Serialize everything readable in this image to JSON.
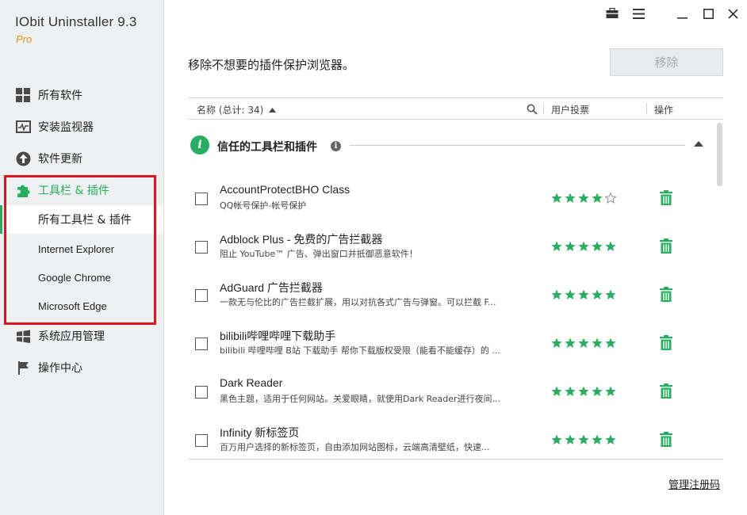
{
  "app": {
    "title": "IObit Uninstaller 9.3",
    "edition": "Pro"
  },
  "sidebar": {
    "items": [
      {
        "label": "所有软件",
        "icon": "grid-icon"
      },
      {
        "label": "安装监视器",
        "icon": "monitor-icon"
      },
      {
        "label": "软件更新",
        "icon": "update-arrow-icon"
      },
      {
        "label": "工具栏 & 插件",
        "icon": "puzzle-icon",
        "active": true
      },
      {
        "label": "系统应用管理",
        "icon": "windows-icon"
      },
      {
        "label": "操作中心",
        "icon": "flag-icon"
      }
    ],
    "subitems": [
      {
        "label": "所有工具栏 & 插件",
        "selected": true
      },
      {
        "label": "Internet Explorer"
      },
      {
        "label": "Google Chrome"
      },
      {
        "label": "Microsoft Edge"
      }
    ]
  },
  "window_controls": [
    "toolbox-icon",
    "menu-icon",
    "minimize-icon",
    "maximize-icon",
    "close-icon"
  ],
  "main": {
    "heading": "移除不想要的插件保护浏览器。",
    "remove_button": "移除",
    "table": {
      "col_name": "名称 (总计: 34)",
      "col_votes": "用户投票",
      "col_action": "操作"
    },
    "group": {
      "title": "信任的工具栏和插件"
    },
    "rows": [
      {
        "name": "AccountProtectBHO Class",
        "desc": "QQ帐号保护-帐号保护",
        "stars": 4
      },
      {
        "name": "Adblock Plus - 免费的广告拦截器",
        "desc": "阻止 YouTube™ 广告、弹出窗口并抵御恶意软件！",
        "stars": 5
      },
      {
        "name": "AdGuard 广告拦截器",
        "desc": "一款无与伦比的广告拦截扩展，用以对抗各式广告与弹窗。可以拦截 F...",
        "stars": 5
      },
      {
        "name": "bilibili哔哩哔哩下载助手",
        "desc": "bilibili 哔哩哔哩 B站 下载助手 帮你下载版权受限（能看不能缓存）的 ...",
        "stars": 5
      },
      {
        "name": "Dark Reader",
        "desc": "黑色主题，适用于任何网站。关爱眼睛，就使用Dark Reader进行夜间...",
        "stars": 5
      },
      {
        "name": "Infinity 新标签页",
        "desc": "百万用户选择的新标签页，自由添加网站图标，云端高清壁纸，快速...",
        "stars": 5
      }
    ],
    "manage_link": "管理注册码"
  },
  "colors": {
    "accent": "#27ae60",
    "highlight": "#e0141e",
    "edition": "#d59a12"
  }
}
